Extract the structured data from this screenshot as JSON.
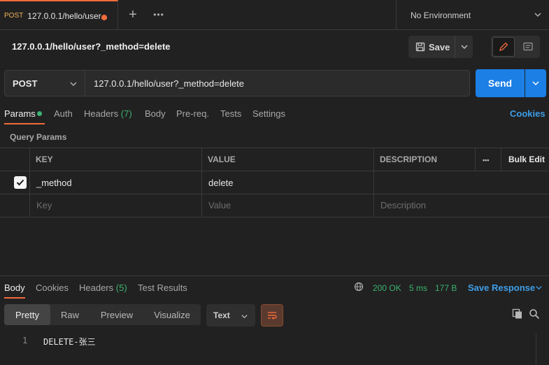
{
  "tab": {
    "method": "POST",
    "title": "127.0.0.1/hello/user..."
  },
  "environment": {
    "label": "No Environment"
  },
  "request": {
    "title": "127.0.0.1/hello/user?_method=delete",
    "save_label": "Save",
    "method": "POST",
    "url": "127.0.0.1/hello/user?_method=delete",
    "send_label": "Send"
  },
  "request_tabs": {
    "params": "Params",
    "auth": "Auth",
    "headers": "Headers",
    "headers_count": "(7)",
    "body": "Body",
    "prereq": "Pre-req.",
    "tests": "Tests",
    "settings": "Settings",
    "cookies": "Cookies"
  },
  "query_params": {
    "label": "Query Params",
    "headers": {
      "key": "KEY",
      "value": "VALUE",
      "description": "DESCRIPTION",
      "more": "•••",
      "bulk_edit": "Bulk Edit"
    },
    "rows": [
      {
        "key": "_method",
        "value": "delete",
        "description": ""
      }
    ],
    "placeholders": {
      "key": "Key",
      "value": "Value",
      "description": "Description"
    }
  },
  "response": {
    "tabs": {
      "body": "Body",
      "cookies": "Cookies",
      "headers": "Headers",
      "headers_count": "(5)",
      "test_results": "Test Results"
    },
    "status": "200 OK",
    "time": "5 ms",
    "size": "177 B",
    "save_response": "Save Response",
    "views": {
      "pretty": "Pretty",
      "raw": "Raw",
      "preview": "Preview",
      "visualize": "Visualize"
    },
    "format": "Text",
    "lines": [
      {
        "no": "1",
        "text": "DELETE-张三"
      }
    ]
  },
  "colors": {
    "accent": "#f26b3a",
    "primary": "#1b7fe6",
    "success": "#3cb371",
    "link": "#3d9ee8"
  }
}
